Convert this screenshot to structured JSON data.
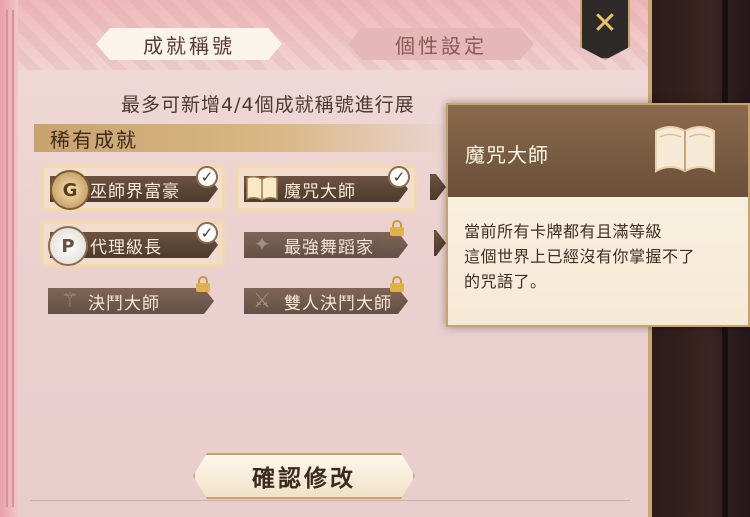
{
  "tabs": [
    {
      "label": "成就稱號",
      "active": true
    },
    {
      "label": "個性設定",
      "active": false
    }
  ],
  "close_icon": "close-x-icon",
  "instruction": "最多可新增4/4個成就稱號進行展",
  "section": {
    "title": "稀有成就"
  },
  "badges": [
    {
      "label": "巫師界富豪",
      "emblem": "G",
      "selected": true,
      "equipped": true,
      "locked": false
    },
    {
      "label": "魔咒大師",
      "emblem": "book",
      "selected": true,
      "equipped": true,
      "locked": false
    },
    {
      "label": "代理級長",
      "emblem": "P",
      "selected": true,
      "equipped": true,
      "locked": false
    },
    {
      "label": "最強舞蹈家",
      "emblem": "dancer",
      "selected": false,
      "equipped": false,
      "locked": true
    },
    {
      "label": "決鬥大師",
      "emblem": "wand",
      "selected": false,
      "equipped": false,
      "locked": true
    },
    {
      "label": "雙人決鬥大師",
      "emblem": "duel",
      "selected": false,
      "equipped": false,
      "locked": true
    }
  ],
  "tooltip": {
    "title": "魔咒大師",
    "icon": "open-book-icon",
    "description": [
      "當前所有卡牌都有且滿等級",
      "這個世界上已經沒有你掌握不了",
      "的咒語了。"
    ]
  },
  "confirm_button": {
    "label": "確認修改"
  },
  "colors": {
    "panel_bg": "#ecd4d3",
    "badge_plate": "#5b4434",
    "gold_accent": "#c9a46a",
    "tooltip_header": "#7a5c44"
  }
}
